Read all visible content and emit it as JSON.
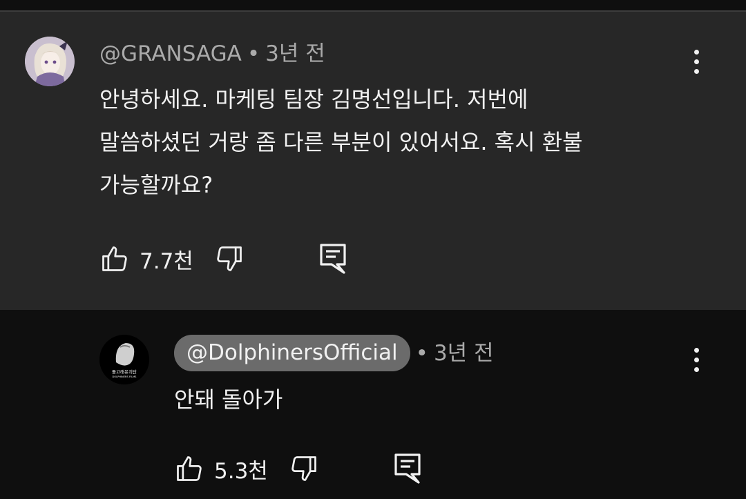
{
  "comment": {
    "handle": "@GRANSAGA",
    "separator": "•",
    "time": "3년 전",
    "lines": [
      "안녕하세요. 마케팅 팀장 김명선입니다. 저번에",
      "말씀하셨던 거랑 좀 다른 부분이 있어서요. 혹시 환불",
      "가능할까요?"
    ],
    "likes": "7.7천"
  },
  "reply": {
    "handle": "@DolphinersOfficial",
    "separator": "•",
    "time": "3년 전",
    "text": "안돼 돌아가",
    "likes": "5.3천",
    "avatar_lines": [
      "돌고래유괴단",
      "DOLPHINERS FILMS"
    ]
  },
  "icons": {
    "like": "thumbs-up-icon",
    "dislike": "thumbs-down-icon",
    "reply": "comment-reply-icon",
    "more": "more-vertical-icon"
  },
  "colors": {
    "comment_bg": "#272727",
    "page_bg": "#0f0f0f",
    "handle_pill": "#6b6b6b",
    "secondary_text": "#aaaaaa",
    "primary_text": "#f1f1f1"
  }
}
